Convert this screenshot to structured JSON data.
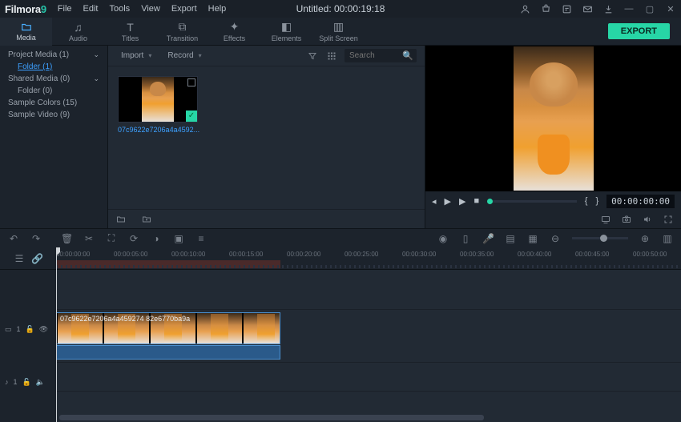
{
  "app": {
    "name": "Filmora",
    "version": "9",
    "title": "Untitled:  00:00:19:18"
  },
  "menu": [
    "File",
    "Edit",
    "Tools",
    "View",
    "Export",
    "Help"
  ],
  "window_icons": [
    "user-icon",
    "cart-icon",
    "bell-icon",
    "mail-icon",
    "download-icon",
    "minimize-icon",
    "maximize-icon",
    "close-icon"
  ],
  "tabs": [
    {
      "label": "Media",
      "icon": "folder"
    },
    {
      "label": "Audio",
      "icon": "audio"
    },
    {
      "label": "Titles",
      "icon": "titles"
    },
    {
      "label": "Transition",
      "icon": "transition"
    },
    {
      "label": "Effects",
      "icon": "effects"
    },
    {
      "label": "Elements",
      "icon": "elements"
    },
    {
      "label": "Split Screen",
      "icon": "split"
    }
  ],
  "export_label": "EXPORT",
  "sidebar": {
    "items": [
      {
        "label": "Project Media (1)",
        "expandable": true
      },
      {
        "label": "Folder (1)",
        "child": true,
        "selected": true
      },
      {
        "label": "Shared Media (0)",
        "expandable": true
      },
      {
        "label": "Folder (0)",
        "child": true
      },
      {
        "label": "Sample Colors (15)"
      },
      {
        "label": "Sample Video (9)"
      }
    ]
  },
  "media_toolbar": {
    "import": "Import",
    "record": "Record",
    "search_placeholder": "Search"
  },
  "thumb": {
    "label": "07c9622e7206a4a4592..."
  },
  "preview": {
    "time": "00:00:00:00",
    "markers": {
      "in": "{",
      "out": "}"
    }
  },
  "ruler": {
    "ticks": [
      "00:00:00:00",
      "00:00:05:00",
      "00:00:10:00",
      "00:00:15:00",
      "00:00:20:00",
      "00:00:25:00",
      "00:00:30:00",
      "00:00:35:00",
      "00:00:40:00",
      "00:00:45:00",
      "00:00:50:00"
    ]
  },
  "tracks": {
    "video": {
      "name": "1"
    },
    "audio": {
      "name": "1"
    },
    "clip_label": "07c9622e7206a4a459274 82e6770ba9a"
  }
}
